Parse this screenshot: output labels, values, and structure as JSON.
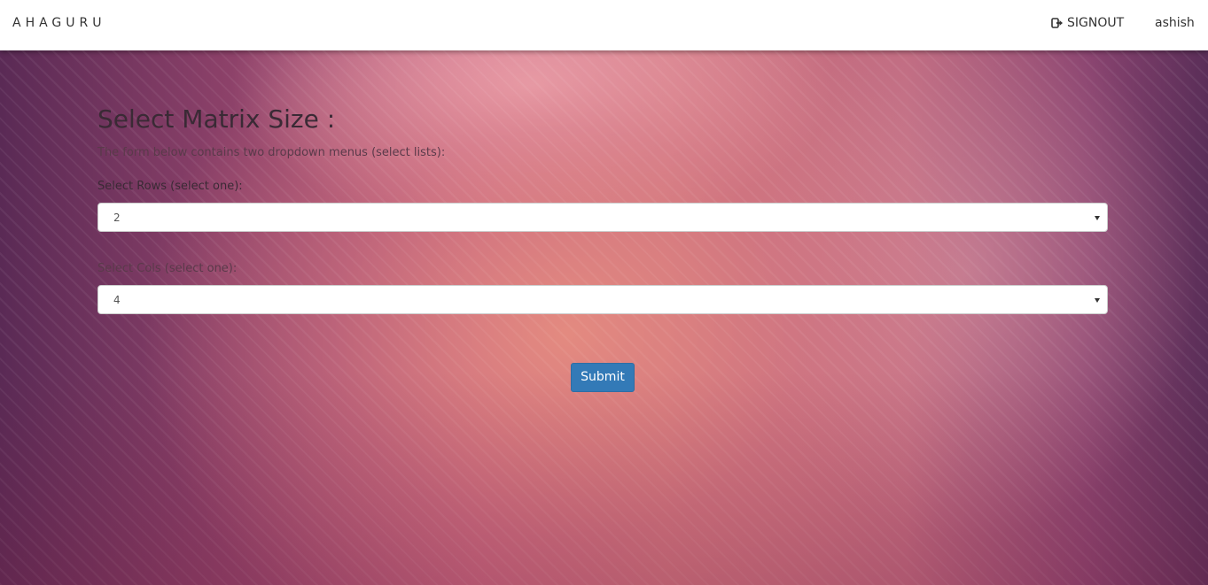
{
  "nav": {
    "brand": "AHAGURU",
    "signout_label": "SIGNOUT",
    "username": "ashish"
  },
  "form": {
    "title": "Select Matrix Size :",
    "description": "The form below contains two dropdown menus (select lists):",
    "rows_label": "Select Rows (select one):",
    "rows_value": "2",
    "cols_label": "Select Cols (select one):",
    "cols_value": "4",
    "submit_label": "Submit"
  },
  "colors": {
    "primary_button": "#337ab7",
    "navbar": "#ffffff"
  },
  "icons": {
    "signout": "sign-out-icon",
    "dropdown": "caret-down-icon"
  }
}
